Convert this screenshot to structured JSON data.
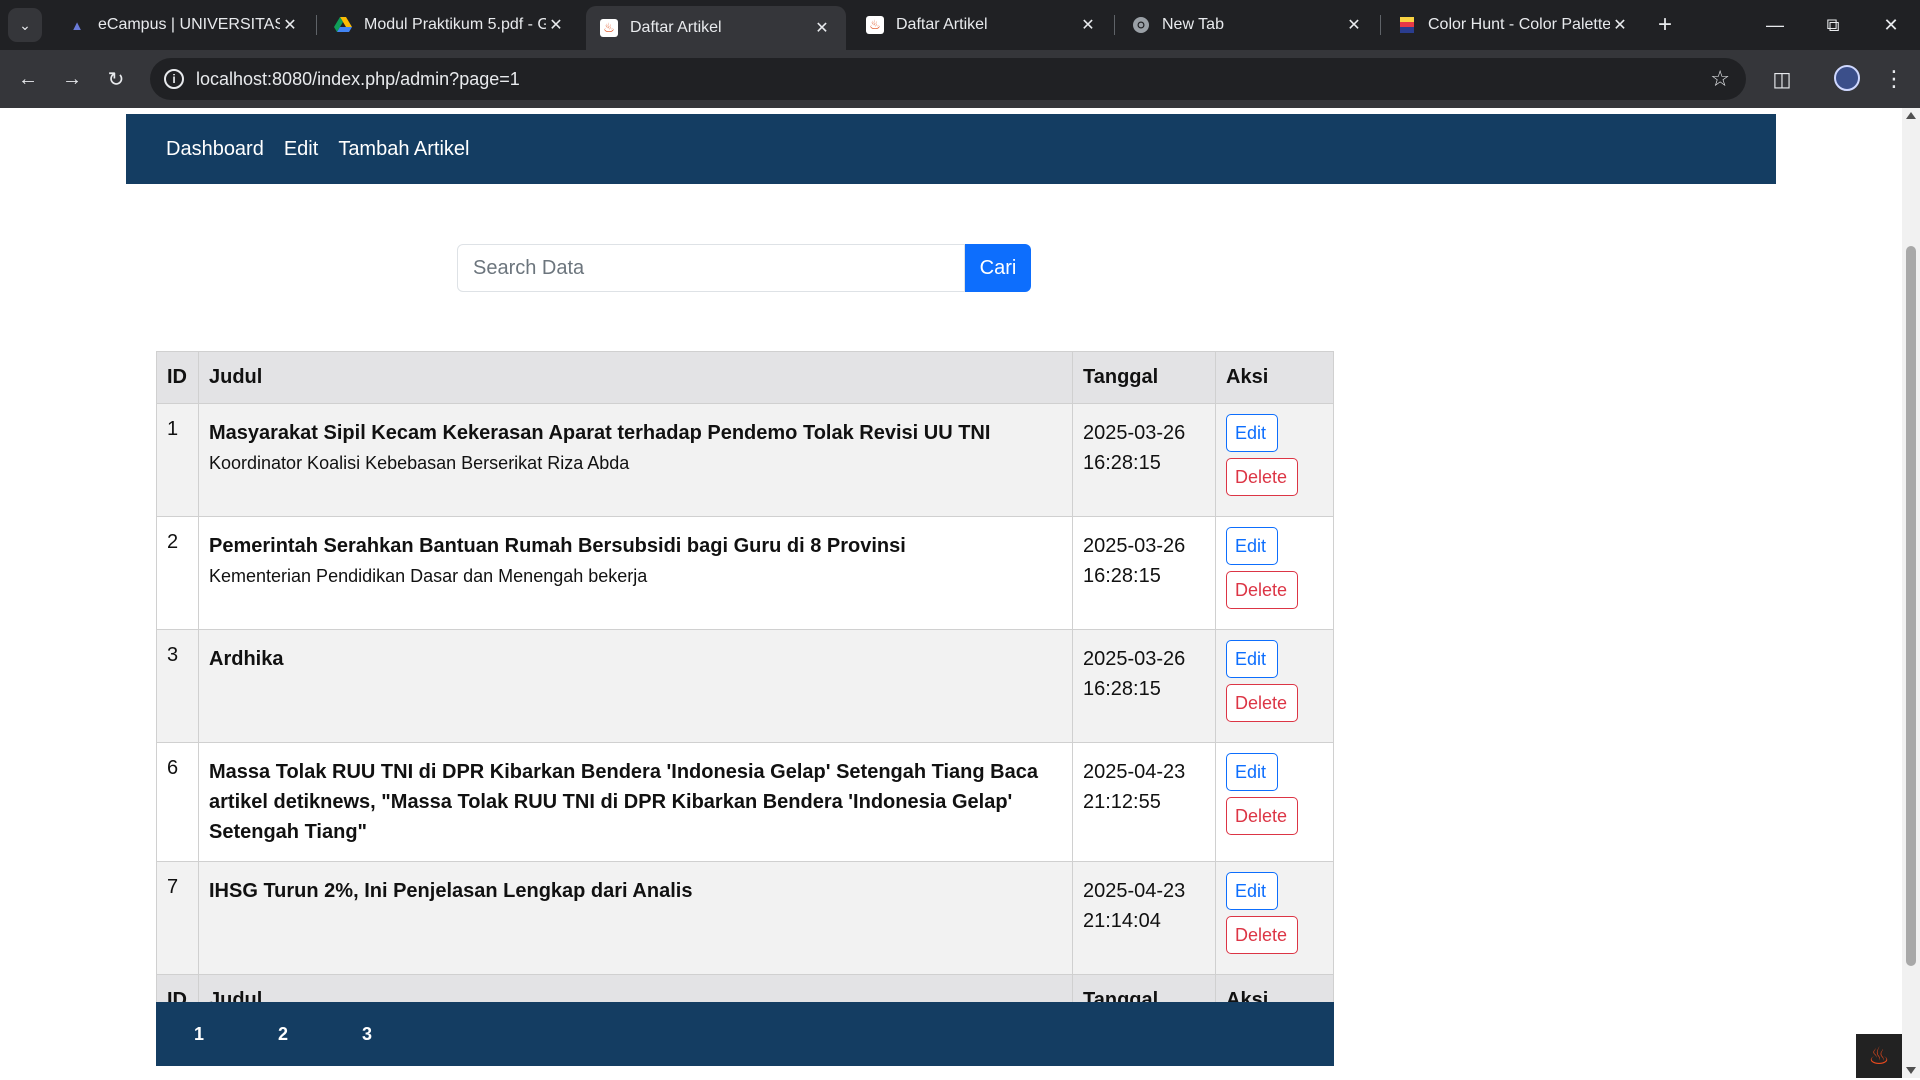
{
  "browser": {
    "tabs": [
      {
        "title": "eCampus | UNIVERSITAS PE",
        "favicon": "ecampus-icon",
        "active": false
      },
      {
        "title": "Modul Praktikum 5.pdf - G",
        "favicon": "drive-icon",
        "active": false
      },
      {
        "title": "Daftar Artikel",
        "favicon": "codeigniter-icon",
        "active": true
      },
      {
        "title": "Daftar Artikel",
        "favicon": "codeigniter-icon",
        "active": false
      },
      {
        "title": "New Tab",
        "favicon": "chrome-icon",
        "active": false
      },
      {
        "title": "Color Hunt - Color Palettes",
        "favicon": "colorhunt-icon",
        "active": false
      }
    ],
    "url": "localhost:8080/index.php/admin?page=1"
  },
  "navbar": {
    "items": [
      "Dashboard",
      "Edit",
      "Tambah Artikel"
    ],
    "bg_color": "#143d62"
  },
  "search": {
    "placeholder": "Search Data",
    "value": "",
    "button_label": "Cari",
    "button_color": "#0d6efd"
  },
  "table": {
    "headers": [
      "ID",
      "Judul",
      "Tanggal",
      "Aksi"
    ],
    "rows": [
      {
        "id": "1",
        "judul": "Masyarakat Sipil Kecam Kekerasan Aparat terhadap Pendemo Tolak Revisi UU TNI",
        "ringkasan": "Koordinator Koalisi Kebebasan Berserikat Riza Abda",
        "tanggal": "2025-03-26",
        "waktu": "16:28:15",
        "edit": "Edit",
        "delete": "Delete"
      },
      {
        "id": "2",
        "judul": "Pemerintah Serahkan Bantuan Rumah Bersubsidi bagi Guru di 8 Provinsi",
        "ringkasan": "Kementerian Pendidikan Dasar dan Menengah bekerja",
        "tanggal": "2025-03-26",
        "waktu": "16:28:15",
        "edit": "Edit",
        "delete": "Delete"
      },
      {
        "id": "3",
        "judul": "Ardhika",
        "ringkasan": "",
        "tanggal": "2025-03-26",
        "waktu": "16:28:15",
        "edit": "Edit",
        "delete": "Delete"
      },
      {
        "id": "6",
        "judul": "Massa Tolak RUU TNI di DPR Kibarkan Bendera 'Indonesia Gelap' Setengah Tiang Baca artikel detiknews, \"Massa Tolak RUU TNI di DPR Kibarkan Bendera 'Indonesia Gelap' Setengah Tiang\"",
        "ringkasan": "",
        "tanggal": "2025-04-23",
        "waktu": "21:12:55",
        "edit": "Edit",
        "delete": "Delete"
      },
      {
        "id": "7",
        "judul": "IHSG Turun 2%, Ini Penjelasan Lengkap dari Analis",
        "ringkasan": "",
        "tanggal": "2025-04-23",
        "waktu": "21:14:04",
        "edit": "Edit",
        "delete": "Delete"
      }
    ],
    "footer": [
      "ID",
      "Judul",
      "Tanggal",
      "Aksi"
    ]
  },
  "pagination": {
    "pages": [
      "1",
      "2",
      "3"
    ],
    "current": "1"
  }
}
